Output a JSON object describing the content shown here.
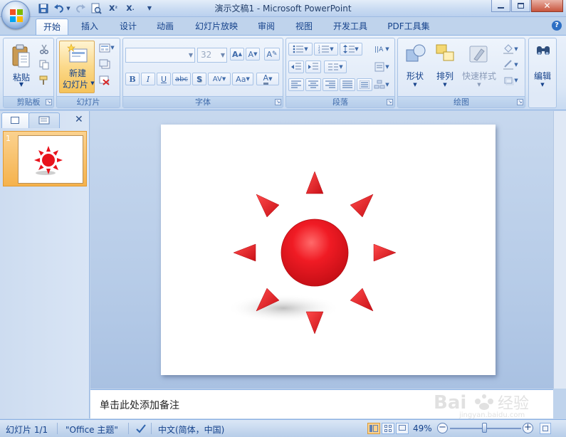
{
  "window": {
    "title": "演示文稿1 - Microsoft PowerPoint",
    "controls": {
      "minimize": "minimize-icon",
      "restore": "restore-icon",
      "close": "close-icon"
    }
  },
  "quick_access": [
    "save-icon",
    "undo-icon",
    "redo-icon",
    "print-preview-icon",
    "custom-icon",
    "close-doc-icon",
    "customize-qat-icon"
  ],
  "ribbon": {
    "tabs": [
      "开始",
      "插入",
      "设计",
      "动画",
      "幻灯片放映",
      "审阅",
      "视图",
      "开发工具",
      "PDF工具集"
    ],
    "active_tab": "开始",
    "groups": {
      "clipboard": {
        "label": "剪贴板",
        "paste_label": "粘贴"
      },
      "slides": {
        "label": "幻灯片",
        "new_slide_label_line1": "新建",
        "new_slide_label_line2": "幻灯片"
      },
      "font": {
        "label": "字体",
        "font_name": "",
        "font_size": "32"
      },
      "paragraph": {
        "label": "段落"
      },
      "drawing": {
        "label": "绘图",
        "shapes_label": "形状",
        "arrange_label": "排列",
        "quick_styles_label": "快速样式"
      },
      "editing": {
        "label": "编辑"
      }
    }
  },
  "slides_pane": {
    "tabs": [
      "slides-tab-icon",
      "outline-tab-icon"
    ],
    "thumbnail_number": "1"
  },
  "slide": {
    "content": "red-sun-shape",
    "sun_color": "#e8131c"
  },
  "notes": {
    "placeholder": "单击此处添加备注"
  },
  "statusbar": {
    "slide_counter": "幻灯片 1/1",
    "theme": "\"Office 主题\"",
    "language": "中文(简体，中国)",
    "zoom": "49%",
    "zoom_fraction": 0.49
  },
  "watermark": "Baidu经验 jingyan.baidu.com"
}
